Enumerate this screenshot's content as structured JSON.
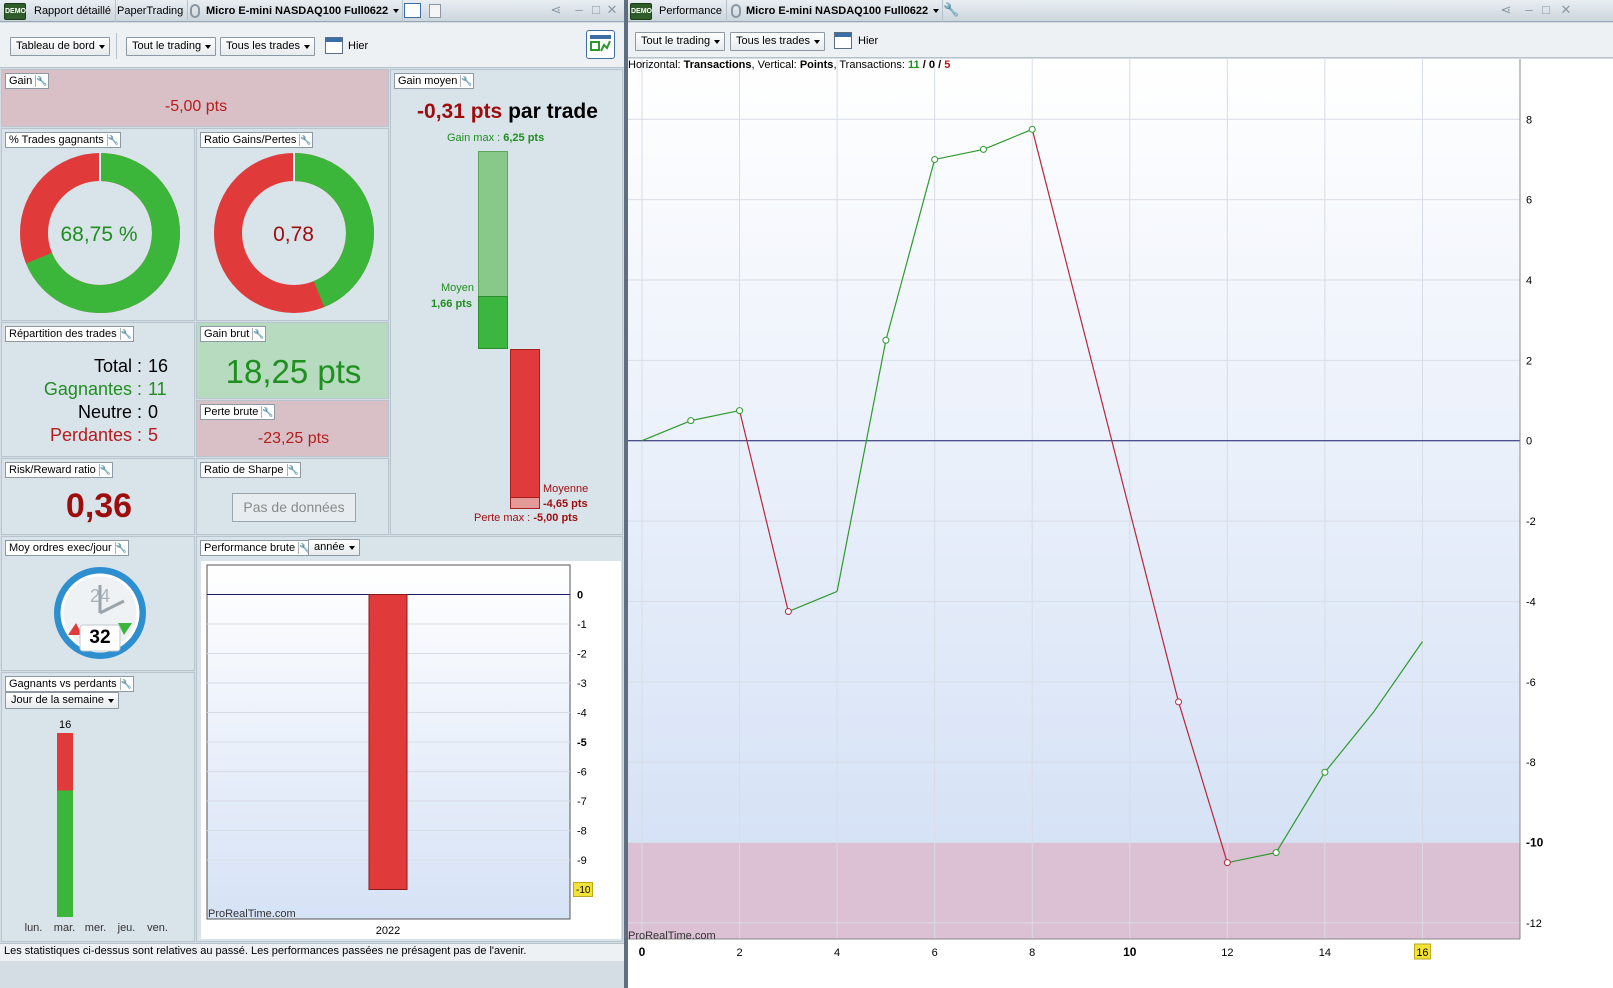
{
  "left_window": {
    "tabs": [
      "Rapport détaillé",
      "PaperTrading"
    ],
    "instrument": "Micro E-mini NASDAQ100 Full0622",
    "logo_text": "DEMO"
  },
  "right_window": {
    "tab": "Performance",
    "instrument": "Micro E-mini NASDAQ100 Full0622",
    "logo_text": "DEMO"
  },
  "left_toolbar": {
    "dashboard": "Tableau de bord",
    "trading": "Tout le trading",
    "trades": "Tous les trades",
    "date": "Hier"
  },
  "right_toolbar": {
    "trading": "Tout le trading",
    "trades": "Tous les trades",
    "date": "Hier"
  },
  "gain": {
    "label": "Gain",
    "value": "-5,00 pts"
  },
  "gain_moyen": {
    "label": "Gain moyen",
    "value": "-0,31 pts",
    "suffix": "par trade",
    "gain_max_label": "Gain max :",
    "gain_max_value": "6,25 pts",
    "moyen_label": "Moyen",
    "moyen_value": "1,66 pts",
    "moyenne_label": "Moyenne",
    "moyenne_value": "-4,65 pts",
    "perte_max_label": "Perte max :",
    "perte_max_value": "-5,00 pts",
    "gain_max_num": 6.25,
    "moyen_num": 1.66,
    "moyenne_num": -4.65,
    "perte_max_num": -5.0
  },
  "pct_gagnants": {
    "label": "% Trades gagnants",
    "value": "68,75 %",
    "fraction": 0.6875
  },
  "ratio": {
    "label": "Ratio Gains/Pertes",
    "value": "0,78",
    "fraction": 0.438
  },
  "repartition": {
    "label": "Répartition des trades",
    "total_label": "Total :",
    "total": "16",
    "gagnantes_label": "Gagnantes :",
    "gagnantes": "11",
    "neutre_label": "Neutre :",
    "neutre": "0",
    "perdantes_label": "Perdantes :",
    "perdantes": "5"
  },
  "gain_brut": {
    "label": "Gain brut",
    "value": "18,25 pts"
  },
  "perte_brute": {
    "label": "Perte brute",
    "value": "-23,25 pts"
  },
  "risk_reward": {
    "label": "Risk/Reward ratio",
    "value": "0,36"
  },
  "sharpe": {
    "label": "Ratio de Sharpe",
    "value": "Pas de données"
  },
  "moy_ordres": {
    "label": "Moy ordres exec/jour",
    "clock_top": "24",
    "clock_bottom": "32"
  },
  "gagnants_vs_perdants": {
    "label": "Gagnants vs perdants",
    "period": "Jour de la semaine",
    "days": [
      "lun.",
      "mar.",
      "mer.",
      "jeu.",
      "ven."
    ],
    "count_label": "16"
  },
  "perf_brute": {
    "label": "Performance brute",
    "period": "année",
    "watermark": "ProRealTime.com",
    "badge": "-10"
  },
  "performance_chart": {
    "header_prefix": "Horizontal:",
    "header_h": "Transactions",
    "header_mid": ", Vertical:",
    "header_v": "Points",
    "header_tx": ", Transactions:",
    "tx_win": "11",
    "tx_sep1": "/",
    "tx_neutral": "0",
    "tx_sep2": "/",
    "tx_loss": "5",
    "watermark": "ProRealTime.com",
    "x_badge": "16"
  },
  "status_text": "Les statistiques ci-dessus sont relatives au passé. Les performances passées ne présagent pas de l'avenir.",
  "chart_data": [
    {
      "type": "line",
      "title": "",
      "xlabel": "Transactions",
      "ylabel": "Points",
      "x": [
        0,
        1,
        2,
        3,
        4,
        5,
        6,
        7,
        8,
        11,
        12,
        13,
        14,
        15,
        16
      ],
      "y": [
        0,
        0.5,
        0.75,
        -4.25,
        -3.75,
        2.5,
        7.0,
        7.25,
        7.75,
        -6.5,
        -10.5,
        -10.25,
        -8.25,
        -6.75,
        -5.0
      ],
      "xlim": [
        0,
        18
      ],
      "ylim": [
        -12.4,
        9.5
      ],
      "x_ticks": [
        "0",
        "2",
        "4",
        "6",
        "8",
        "10",
        "12",
        "14",
        "16"
      ],
      "y_ticks": [
        "8",
        "6",
        "4",
        "2",
        "0",
        "-2",
        "-4",
        "-6",
        "-8",
        "-10",
        "-12"
      ],
      "drawdown_level": -10,
      "grid": true
    },
    {
      "type": "bar",
      "title": "",
      "categories": [
        "2022"
      ],
      "values": [
        -10
      ],
      "ylim": [
        -11,
        1
      ],
      "y_ticks": [
        "0",
        "-1",
        "-2",
        "-3",
        "-4",
        "-5",
        "-6",
        "-7",
        "-8",
        "-9"
      ],
      "grid": true
    },
    {
      "type": "bar",
      "title": "",
      "categories": [
        "lun.",
        "mar.",
        "mer.",
        "jeu.",
        "ven."
      ],
      "series": [
        {
          "values": [
            0,
            11,
            0,
            0,
            0
          ],
          "color": "#3bb63b"
        },
        {
          "values": [
            0,
            5,
            0,
            0,
            0
          ],
          "color": "#e03a3a"
        }
      ]
    }
  ]
}
